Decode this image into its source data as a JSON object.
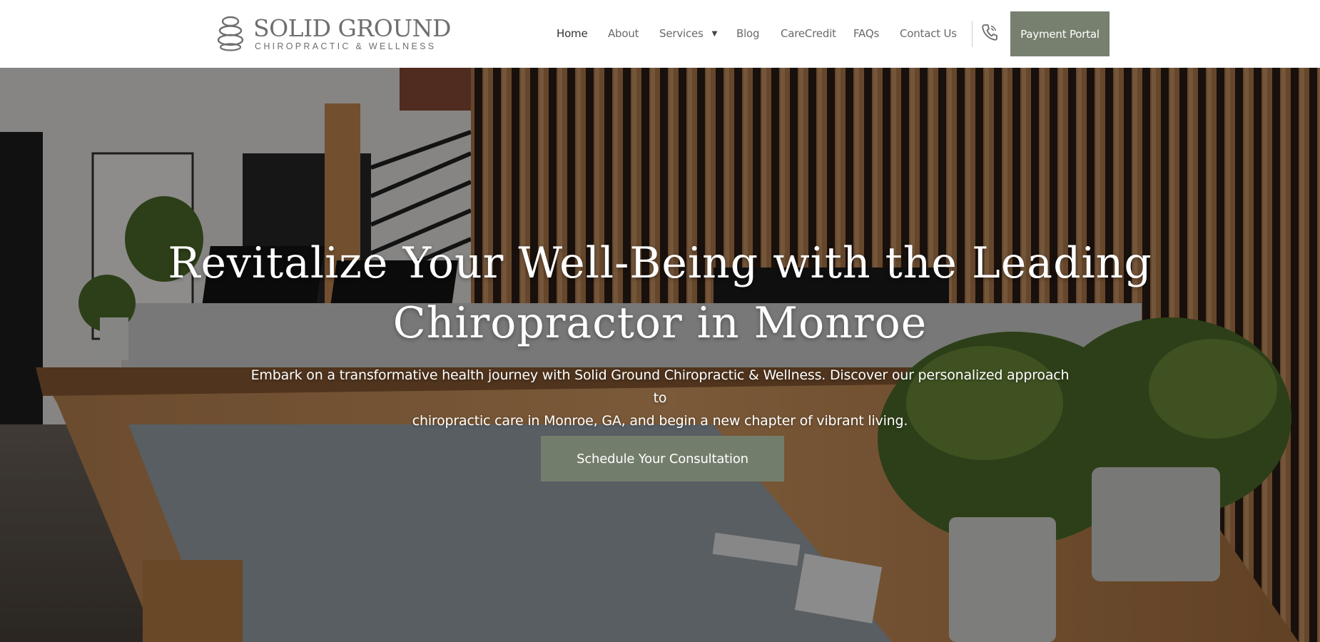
{
  "brand": {
    "name": "SOLID GROUND",
    "tagline": "CHIROPRACTIC & WELLNESS"
  },
  "nav": {
    "items": [
      {
        "label": "Home",
        "active": true
      },
      {
        "label": "About"
      },
      {
        "label": "Services",
        "dropdown": true
      },
      {
        "label": "Blog"
      },
      {
        "label": "CareCredit"
      },
      {
        "label": "FAQs"
      },
      {
        "label": "Contact Us"
      }
    ],
    "phone_icon": "phone-icon",
    "payment_label": "Payment Portal"
  },
  "hero": {
    "title_line1": "Revitalize Your Well-Being with the Leading",
    "title_line2": "Chiropractor in Monroe",
    "text_line1": "Embark on a transformative health journey with Solid Ground Chiropractic & Wellness. Discover our personalized approach to",
    "text_line2": "chiropractic care in Monroe, GA, and begin a new chapter of vibrant living.",
    "cta_label": "Schedule Your Consultation",
    "background_image": "reception desk with wood slat wall and plants"
  },
  "colors": {
    "accent": "#77806f",
    "nav_text": "#6a6a6a",
    "logo_text": "#6f6f6f"
  }
}
